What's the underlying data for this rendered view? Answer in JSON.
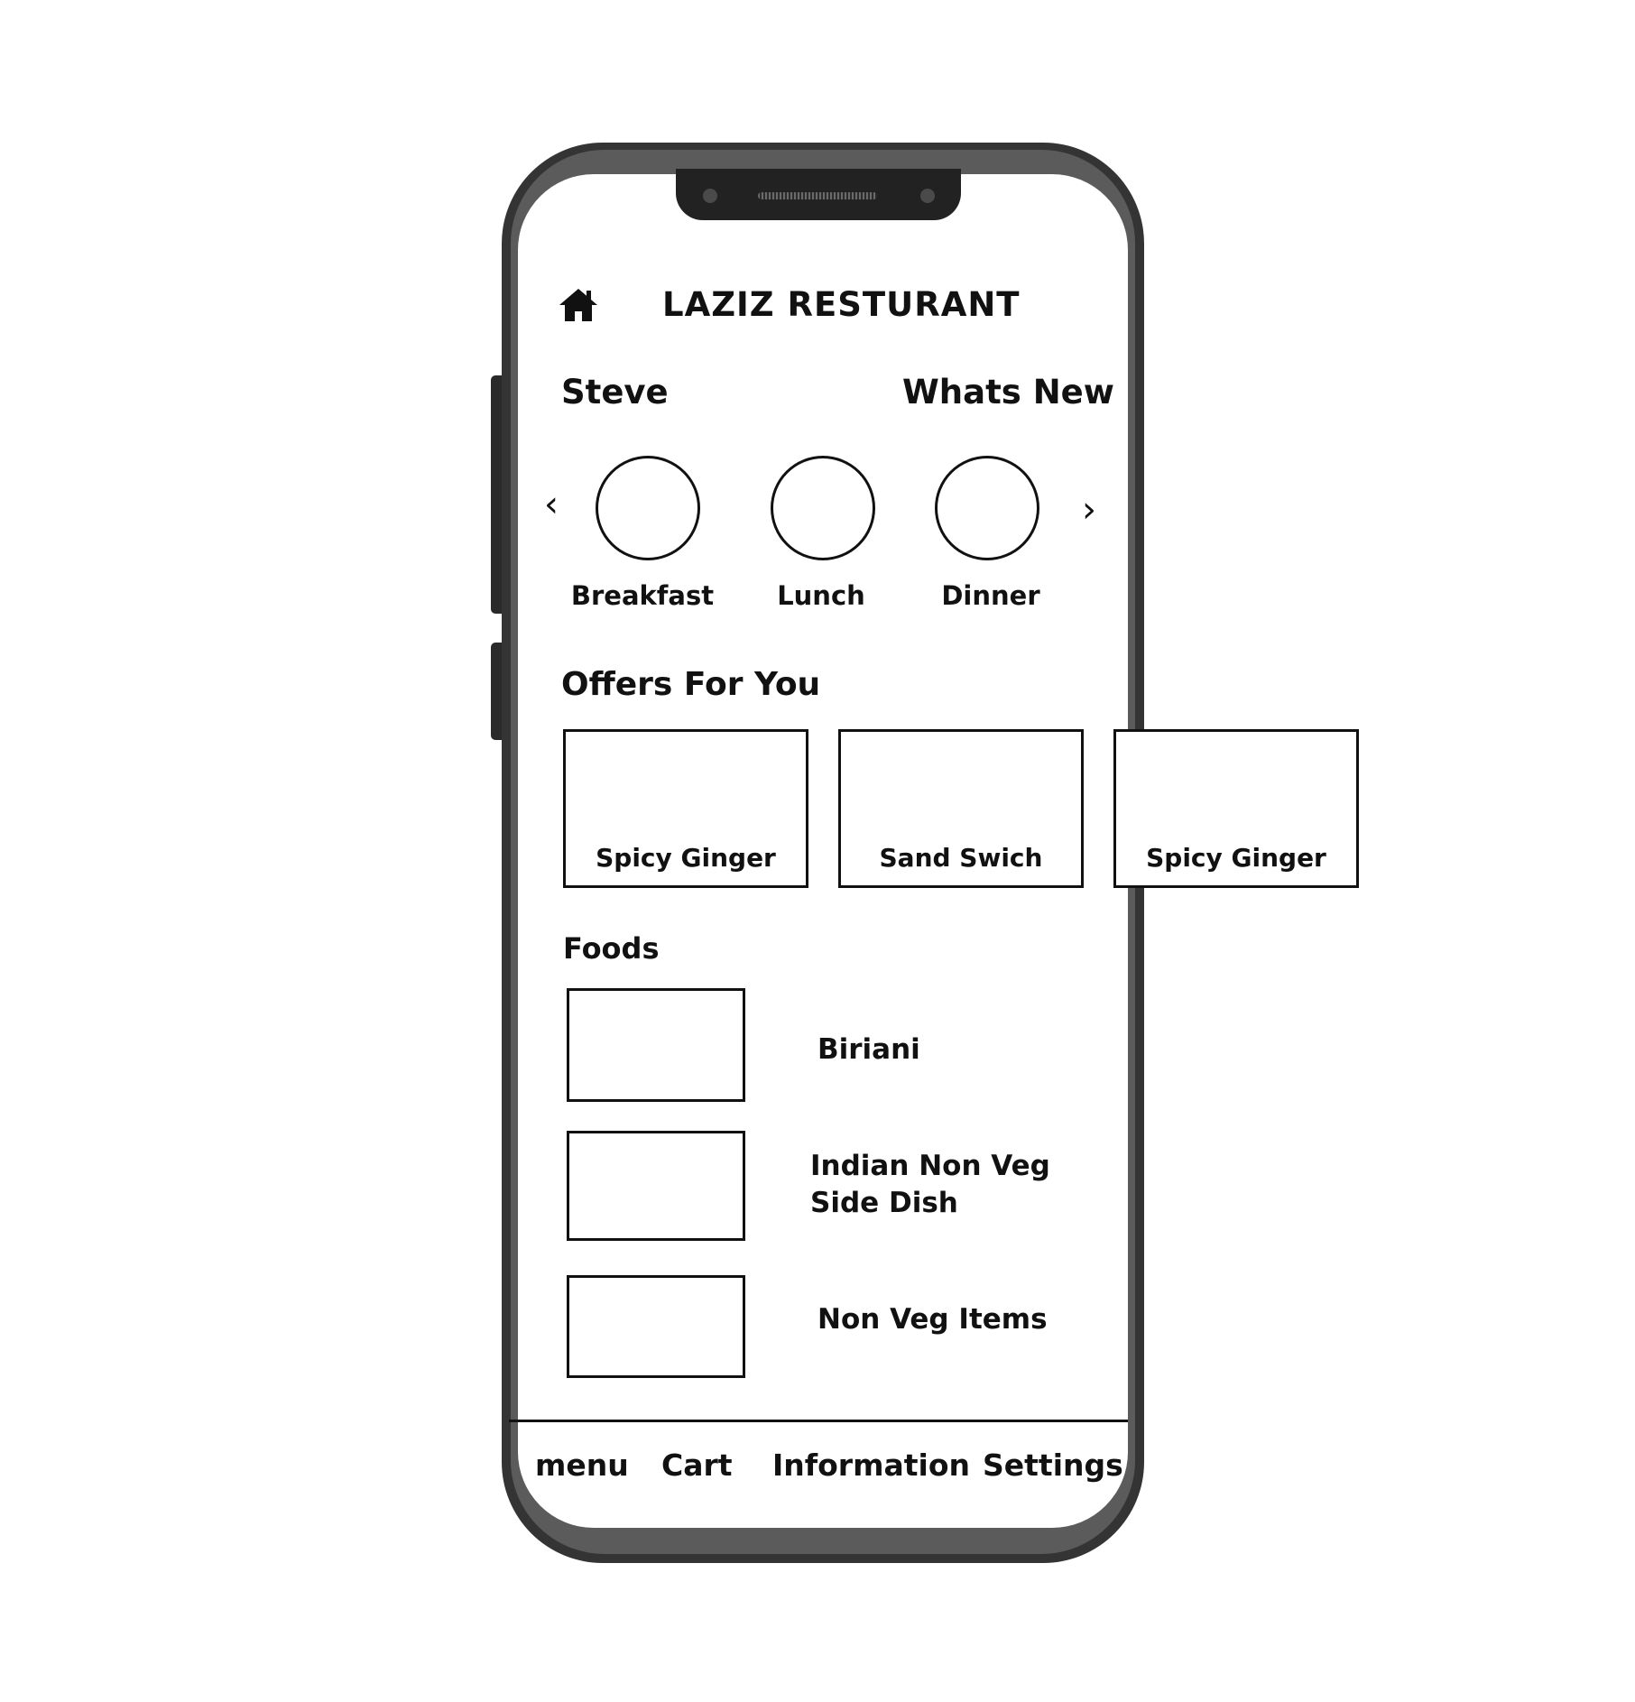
{
  "header": {
    "title": "LAZIZ RESTURANT",
    "home_icon": "home-icon"
  },
  "greeting": {
    "user_name": "Steve",
    "whats_new": "Whats New"
  },
  "categories": {
    "items": [
      {
        "label": "Breakfast"
      },
      {
        "label": "Lunch"
      },
      {
        "label": "Dinner"
      }
    ],
    "prev_icon": "chevron-left-icon",
    "next_icon": "chevron-right-icon",
    "prev_glyph": "‹",
    "next_glyph": "›"
  },
  "offers": {
    "heading": "Offers For You",
    "items": [
      {
        "label": "Spicy Ginger"
      },
      {
        "label": "Sand Swich"
      },
      {
        "label": "Spicy Ginger"
      }
    ]
  },
  "foods": {
    "heading": "Foods",
    "items": [
      {
        "label": "Biriani"
      },
      {
        "label": "Indian Non Veg\nSide Dish"
      },
      {
        "label": "Non Veg Items"
      }
    ]
  },
  "bottom_nav": {
    "items": [
      {
        "label": "menu"
      },
      {
        "label": "Cart"
      },
      {
        "label": "Information"
      },
      {
        "label": "Settings"
      }
    ]
  }
}
